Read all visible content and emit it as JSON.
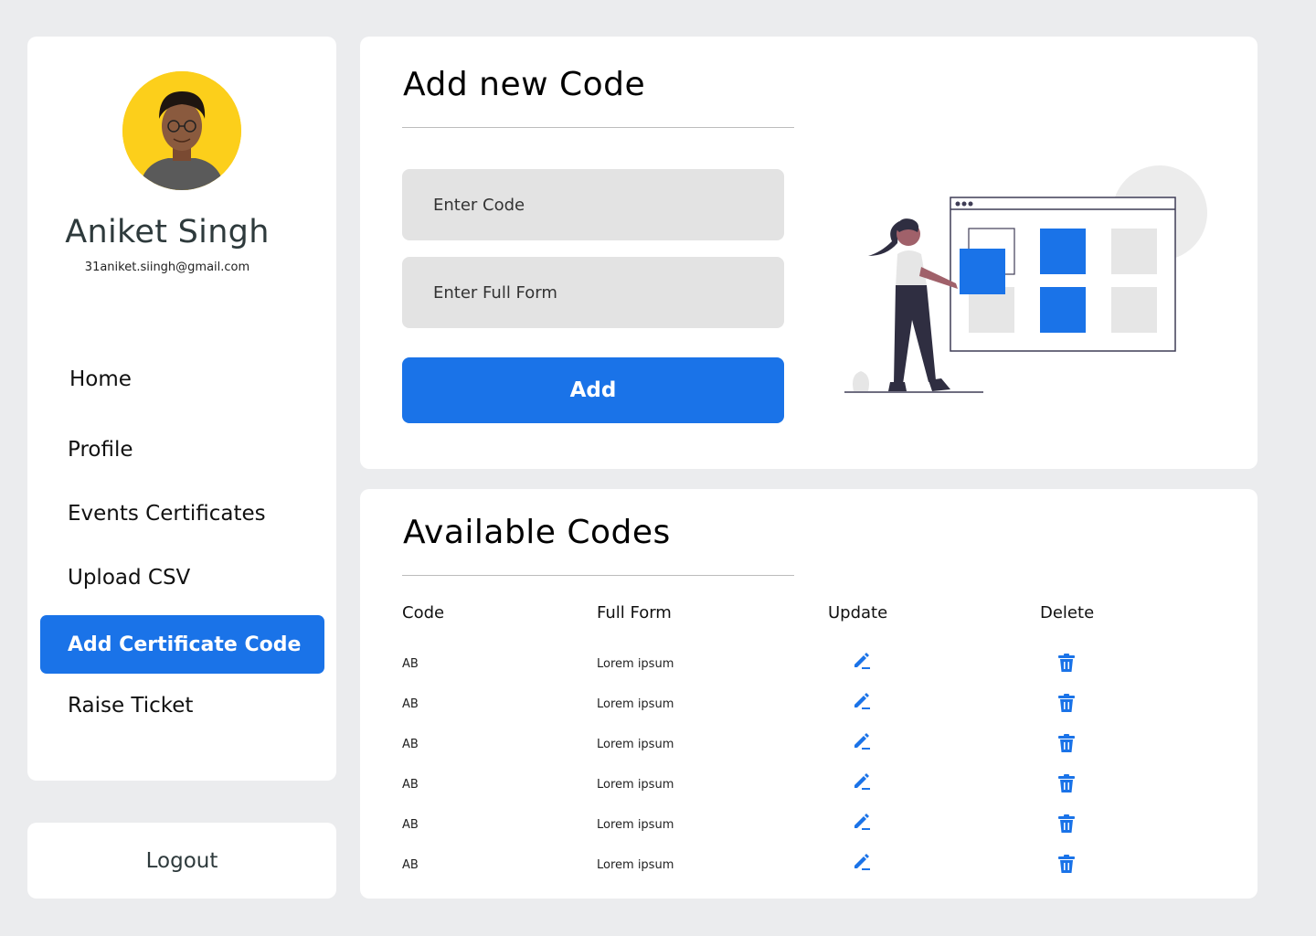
{
  "user": {
    "name": "Aniket Singh",
    "email": "31aniket.siingh@gmail.com"
  },
  "nav": {
    "items": [
      {
        "label": "Home",
        "active": false
      },
      {
        "label": "Profile",
        "active": false
      },
      {
        "label": "Events Certificates",
        "active": false
      },
      {
        "label": "Upload CSV",
        "active": false
      },
      {
        "label": "Add Certificate Code",
        "active": true
      },
      {
        "label": "Raise Ticket",
        "active": false
      }
    ],
    "logout_label": "Logout"
  },
  "add_form": {
    "title": "Add new Code",
    "code_placeholder": "Enter Code",
    "full_form_placeholder": "Enter Full Form",
    "submit_label": "Add"
  },
  "codes_table": {
    "title": "Available Codes",
    "columns": [
      "Code",
      "Full Form",
      "Update",
      "Delete"
    ],
    "rows": [
      {
        "code": "AB",
        "full_form": "Lorem ipsum"
      },
      {
        "code": "AB",
        "full_form": "Lorem ipsum"
      },
      {
        "code": "AB",
        "full_form": "Lorem ipsum"
      },
      {
        "code": "AB",
        "full_form": "Lorem ipsum"
      },
      {
        "code": "AB",
        "full_form": "Lorem ipsum"
      },
      {
        "code": "AB",
        "full_form": "Lorem ipsum"
      }
    ],
    "update_icon": "edit-pen-icon",
    "delete_icon": "trash-icon"
  },
  "colors": {
    "accent": "#1a73e8",
    "avatar_bg": "#fccf1b",
    "page_bg": "#ebecee",
    "input_bg": "#e3e3e3"
  }
}
